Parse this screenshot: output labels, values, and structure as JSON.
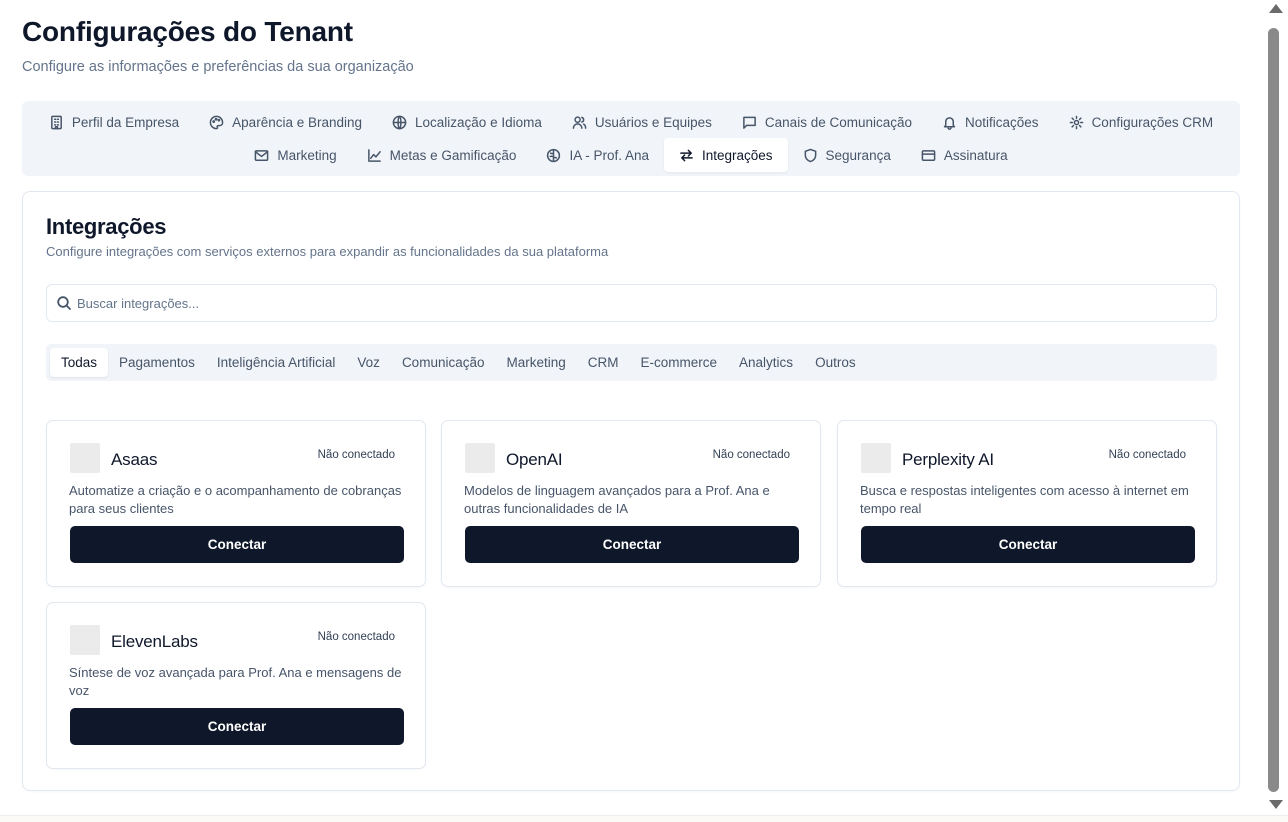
{
  "header": {
    "title": "Configurações do Tenant",
    "subtitle": "Configure as informações e preferências da sua organização"
  },
  "settings_tabs": {
    "row1": [
      {
        "label": "Perfil da Empresa",
        "icon": "building-icon"
      },
      {
        "label": "Aparência e Branding",
        "icon": "palette-icon"
      },
      {
        "label": "Localização e Idioma",
        "icon": "globe-icon"
      },
      {
        "label": "Usuários e Equipes",
        "icon": "users-icon"
      },
      {
        "label": "Canais de Comunicação",
        "icon": "message-square-icon"
      },
      {
        "label": "Notificações",
        "icon": "bell-icon"
      },
      {
        "label": "Configurações CRM",
        "icon": "gear-icon"
      }
    ],
    "row2": [
      {
        "label": "Marketing",
        "icon": "mail-icon"
      },
      {
        "label": "Metas e Gamificação",
        "icon": "chart-line-icon"
      },
      {
        "label": "IA - Prof. Ana",
        "icon": "brain-icon"
      },
      {
        "label": "Integrações",
        "icon": "arrows-swap-icon",
        "active": true
      },
      {
        "label": "Segurança",
        "icon": "shield-icon"
      },
      {
        "label": "Assinatura",
        "icon": "credit-card-icon"
      }
    ]
  },
  "integrations": {
    "title": "Integrações",
    "description": "Configure integrações com serviços externos para expandir as funcionalidades da sua plataforma",
    "search": {
      "placeholder": "Buscar integrações...",
      "value": ""
    },
    "filters": [
      "Todas",
      "Pagamentos",
      "Inteligência Artificial",
      "Voz",
      "Comunicação",
      "Marketing",
      "CRM",
      "E-commerce",
      "Analytics",
      "Outros"
    ],
    "active_filter": "Todas",
    "items": [
      {
        "name": "Asaas",
        "status": "Não conectado",
        "description": "Automatize a criação e o acompanhamento de cobranças para seus clientes",
        "button": "Conectar"
      },
      {
        "name": "OpenAI",
        "status": "Não conectado",
        "description": "Modelos de linguagem avançados para a Prof. Ana e outras funcionalidades de IA",
        "button": "Conectar"
      },
      {
        "name": "Perplexity AI",
        "status": "Não conectado",
        "description": "Busca e respostas inteligentes com acesso à internet em tempo real",
        "button": "Conectar"
      },
      {
        "name": "ElevenLabs",
        "status": "Não conectado",
        "description": "Síntese de voz avançada para Prof. Ana e mensagens de voz",
        "button": "Conectar"
      }
    ]
  },
  "colors": {
    "primary_button": "#0f172a",
    "tab_background": "#f1f5f9",
    "muted_text": "#64748b",
    "border": "#e2e8f0"
  }
}
